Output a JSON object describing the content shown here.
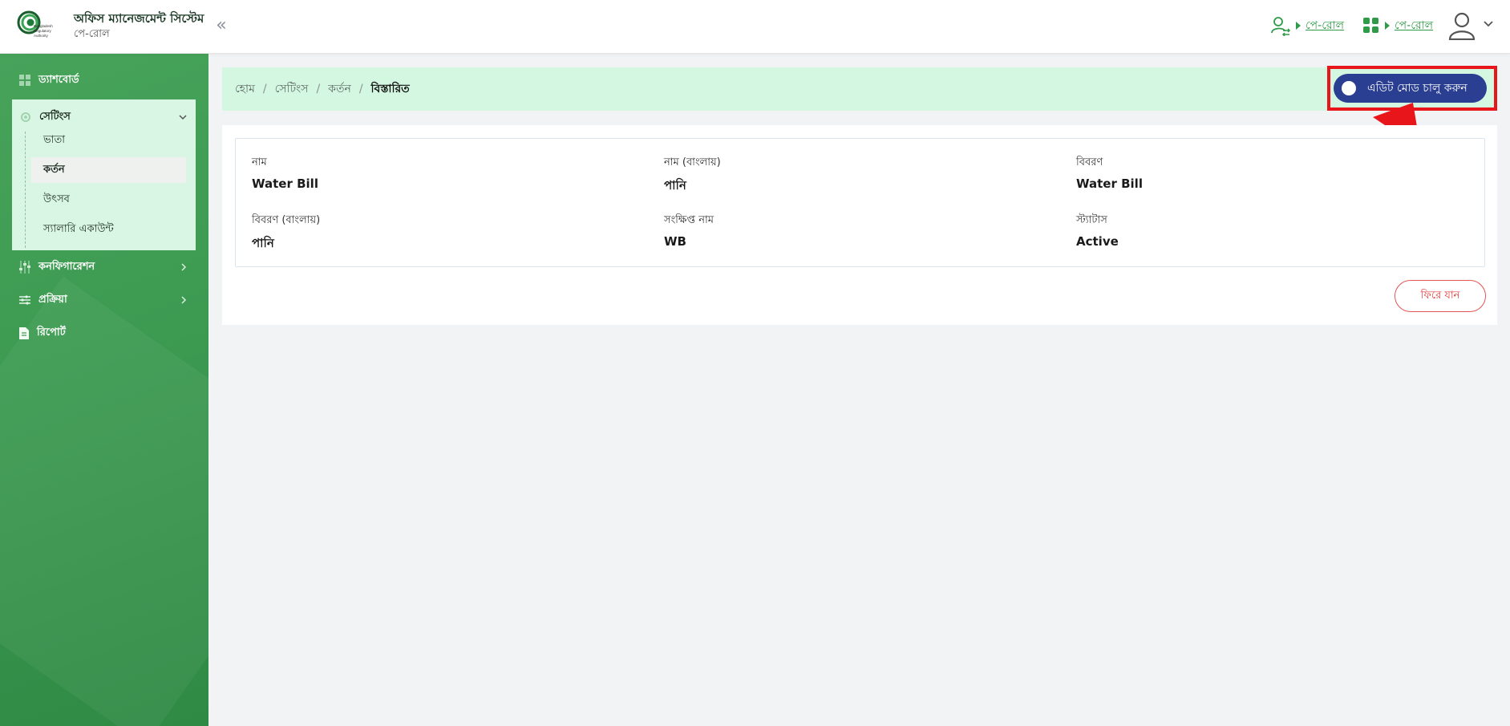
{
  "header": {
    "logo_text": [
      "Bangladesh",
      "Regulatory",
      "Authority"
    ],
    "app_title": "অফিস ম্যানেজমেন্ট সিস্টেম",
    "app_subtitle": "পে-রোল",
    "collapse_icon": "«",
    "links": [
      {
        "icon": "user-switch-icon",
        "label": "পে-রোল"
      },
      {
        "icon": "apps-grid-icon",
        "label": "পে-রোল"
      }
    ]
  },
  "sidebar": {
    "items": [
      {
        "id": "dashboard",
        "label": "ড্যাশবোর্ড",
        "icon": "dashboard-icon"
      },
      {
        "id": "settings",
        "label": "সেটিংস",
        "icon": "gear-icon",
        "expanded": true
      },
      {
        "id": "configuration",
        "label": "কনফিগারেশন",
        "icon": "sliders-icon"
      },
      {
        "id": "process",
        "label": "প্রক্রিয়া",
        "icon": "filter-lines-icon"
      },
      {
        "id": "report",
        "label": "রিপোর্ট",
        "icon": "document-icon"
      }
    ],
    "settings_sub": [
      {
        "label": "ভাতা",
        "active": false
      },
      {
        "label": "কর্তন",
        "active": true
      },
      {
        "label": "উৎসব",
        "active": false
      },
      {
        "label": "স্যালারি একাউন্ট",
        "active": false
      }
    ]
  },
  "breadcrumb": {
    "items": [
      "হোম",
      "সেটিংস",
      "কর্তন"
    ],
    "current": "বিস্তারিত",
    "separator": "/"
  },
  "edit_mode": {
    "label": "এডিট মোড চালু করুন",
    "enabled": false
  },
  "details": {
    "fields": [
      {
        "label": "নাম",
        "value": "Water Bill"
      },
      {
        "label": "নাম (বাংলায়)",
        "value": "পানি"
      },
      {
        "label": "বিবরণ",
        "value": "Water Bill"
      },
      {
        "label": "বিবরণ (বাংলায়)",
        "value": "পানি"
      },
      {
        "label": "সংক্ষিপ্ত নাম",
        "value": "WB"
      },
      {
        "label": "স্ট্যাটাস",
        "value": "Active"
      }
    ]
  },
  "back_button": {
    "label": "ফিরে যান"
  },
  "colors": {
    "brand_green": "#3c9a51",
    "accent_blue": "#2b3f92",
    "breadcrumb_bg": "#d4f7e2",
    "highlight_red": "#e8151b"
  }
}
